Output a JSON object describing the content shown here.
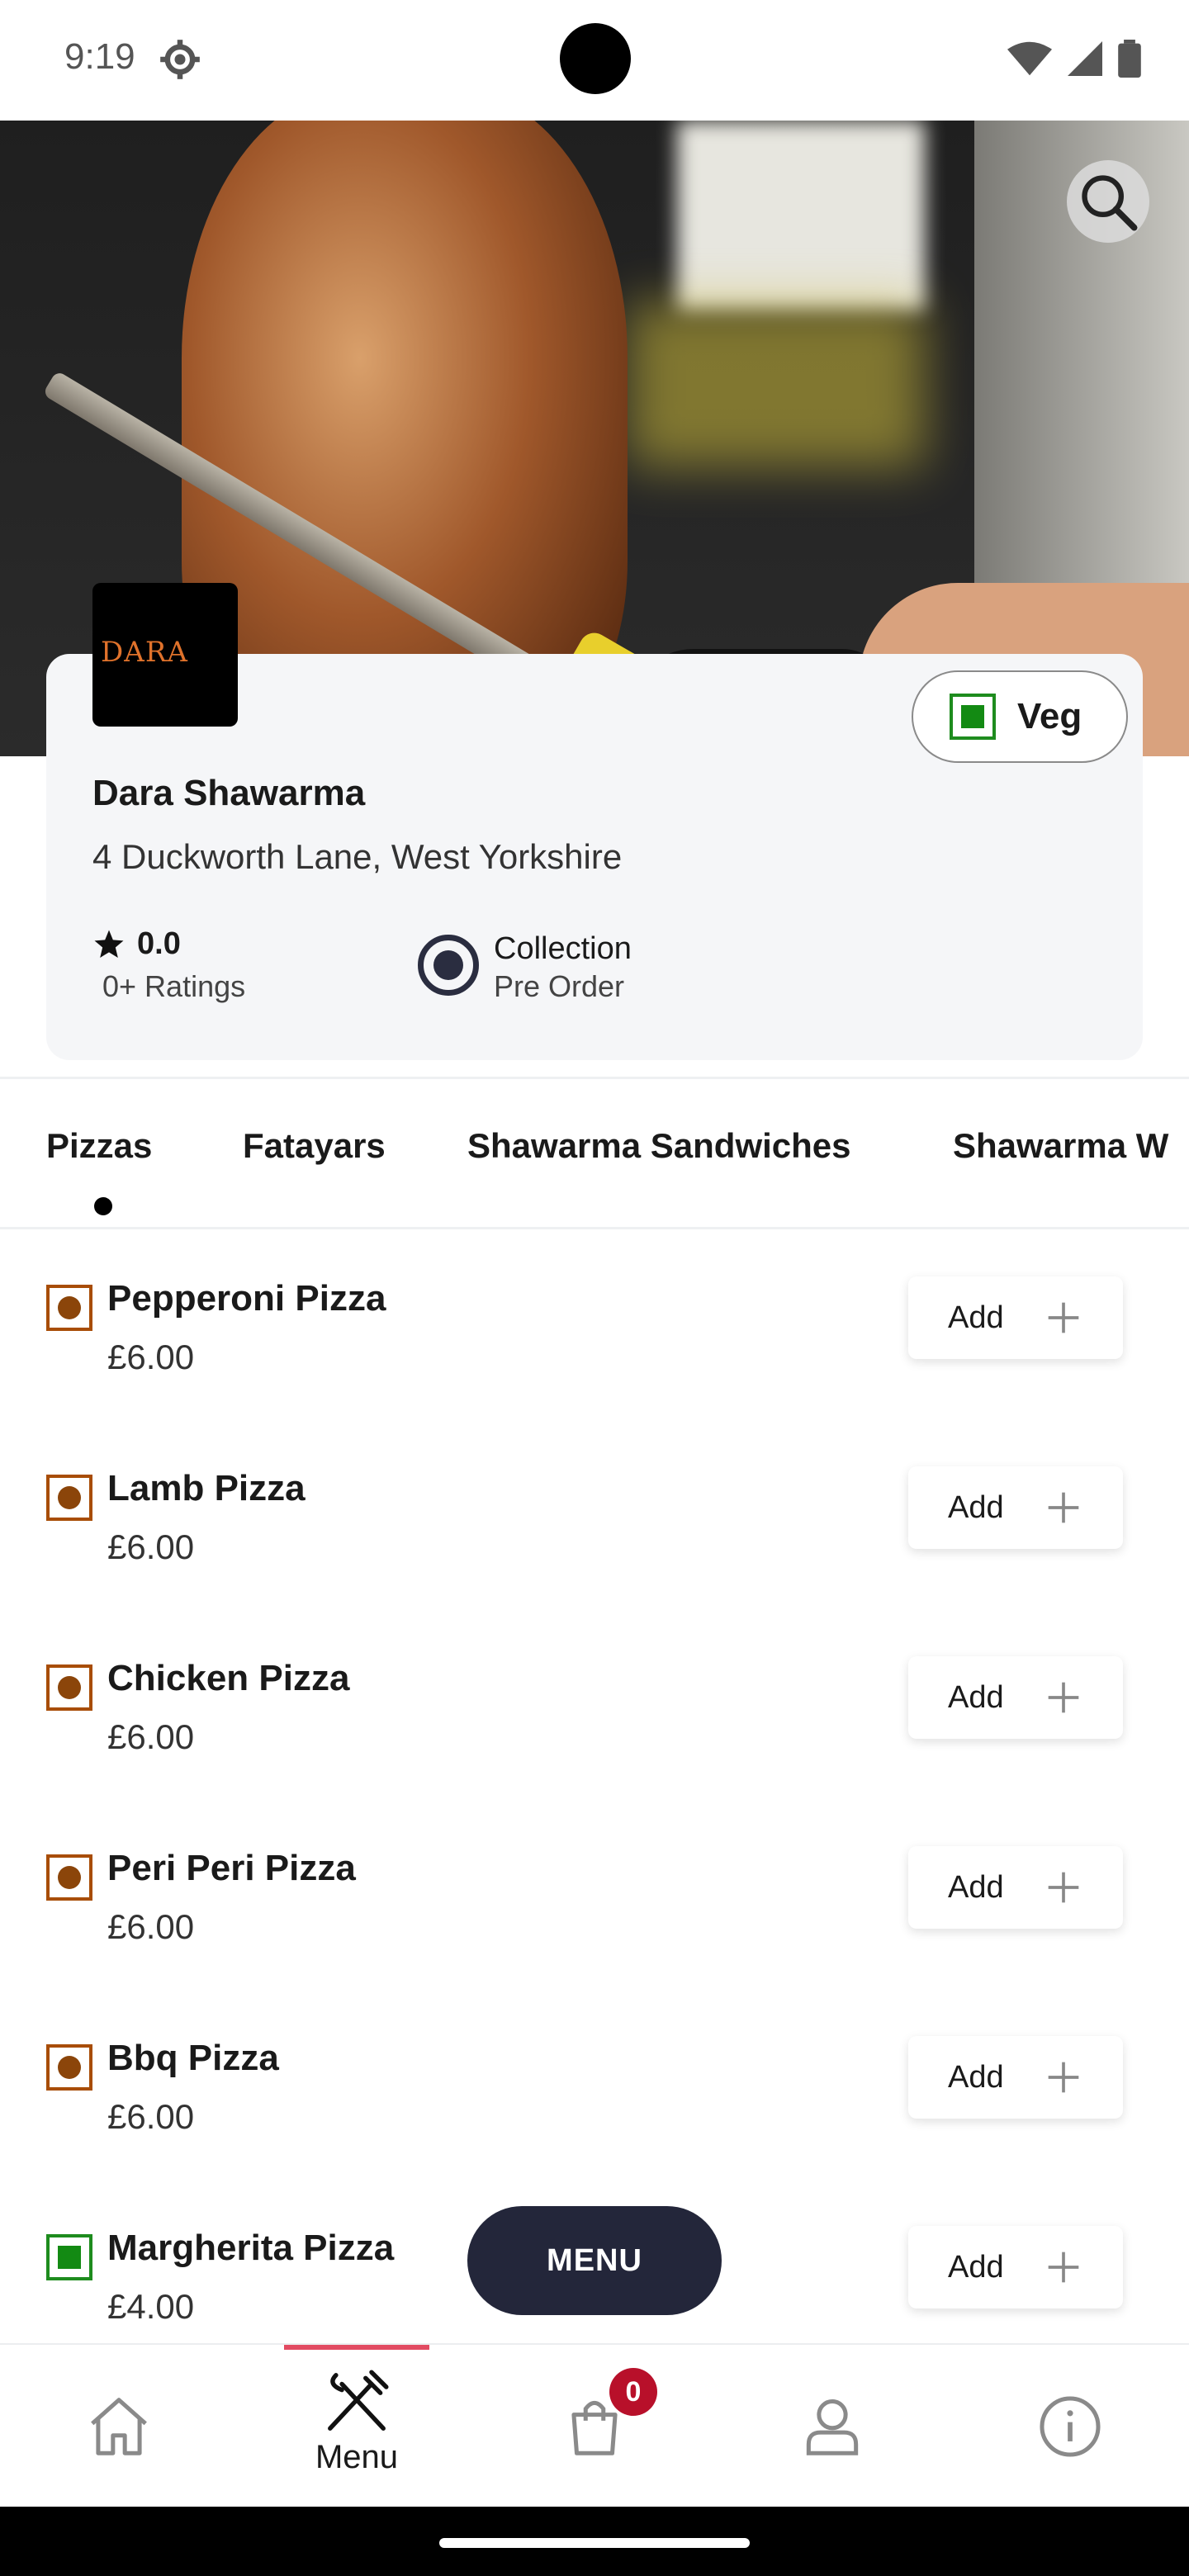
{
  "status_bar": {
    "time": "9:19",
    "icons": [
      "settings-icon",
      "wifi-icon",
      "signal-icon",
      "battery-icon"
    ]
  },
  "restaurant": {
    "logo_text": "DARA",
    "name": "Dara Shawarma",
    "address": "4 Duckworth Lane, West Yorkshire",
    "rating_value": "0.0",
    "rating_count": "0+ Ratings",
    "order_type": "Collection",
    "order_sub": "Pre Order"
  },
  "veg_toggle": {
    "label": "Veg"
  },
  "tabs": [
    {
      "label": "Pizzas"
    },
    {
      "label": "Fatayars"
    },
    {
      "label": "Shawarma Sandwiches"
    },
    {
      "label": "Shawarma W"
    }
  ],
  "menu_items": [
    {
      "name": "Pepperoni Pizza",
      "price": "£6.00",
      "veg": false
    },
    {
      "name": "Lamb Pizza",
      "price": "£6.00",
      "veg": false
    },
    {
      "name": "Chicken Pizza",
      "price": "£6.00",
      "veg": false
    },
    {
      "name": "Peri Peri Pizza",
      "price": "£6.00",
      "veg": false
    },
    {
      "name": "Bbq Pizza",
      "price": "£6.00",
      "veg": false
    },
    {
      "name": "Margherita Pizza",
      "price": "£4.00",
      "veg": true
    }
  ],
  "add_label": "Add",
  "menu_button": "MENU",
  "bottom_nav": {
    "items": [
      {
        "icon": "home-icon",
        "label": ""
      },
      {
        "icon": "fork-knife-icon",
        "label": "Menu"
      },
      {
        "icon": "bag-icon",
        "label": ""
      },
      {
        "icon": "user-icon",
        "label": ""
      },
      {
        "icon": "info-icon",
        "label": ""
      }
    ],
    "cart_count": "0"
  },
  "colors": {
    "accent": "#e24b62",
    "dark": "#23263a",
    "veg": "#138a13",
    "nonveg": "#8b450a",
    "badge": "#b8102a"
  }
}
